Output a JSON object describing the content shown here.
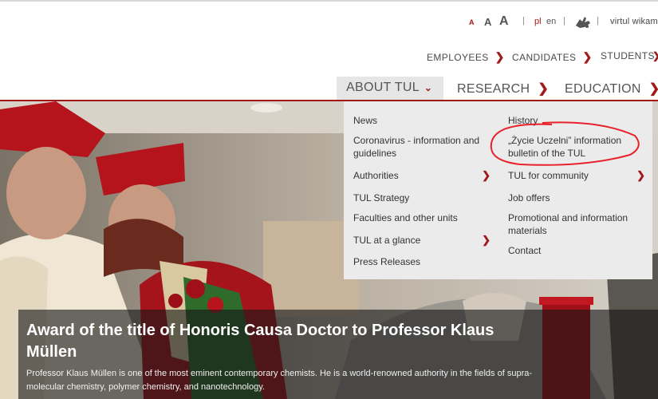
{
  "utility": {
    "font_small": "A",
    "font_medium": "A",
    "font_large": "A",
    "sep": "|",
    "lang_pl": "pl",
    "lang_en": "en",
    "virtual_label": "virtul wikam"
  },
  "sections": [
    {
      "label": "EMPLOYEES",
      "chev": "❯"
    },
    {
      "label": "CANDIDATES",
      "chev": "❯"
    },
    {
      "label": "STUDENTS"
    }
  ],
  "sections_more": "❯",
  "mainnav": {
    "about": "ABOUT TUL",
    "about_chev": "⌄",
    "research": "RESEARCH",
    "education": "EDUCATION",
    "arrow": "❯"
  },
  "dropdown": {
    "left": [
      {
        "label": "News"
      },
      {
        "label": "Coronavirus - information and guidelines"
      },
      {
        "label": "Authorities",
        "arrow": "❯"
      },
      {
        "label": "TUL Strategy"
      },
      {
        "label": "Faculties and other units"
      },
      {
        "label": "TUL at a glance",
        "arrow": "❯"
      },
      {
        "label": "Press Releases"
      }
    ],
    "right": [
      {
        "label": "History"
      },
      {
        "label": "„Życie Uczelni” information bulletin of the TUL"
      },
      {
        "label": "TUL for community",
        "arrow": "❯"
      },
      {
        "label": "Job offers"
      },
      {
        "label": "Promotional and information materials"
      },
      {
        "label": "Contact"
      }
    ]
  },
  "hero": {
    "title": "Award of the title of Honoris Causa Doctor to Professor Klaus Müllen",
    "text": "Professor Klaus Müllen is one of the most eminent contemporary chemists. He is a world-renowned authority in the fields of supra-molecular chemistry, polymer chemistry, and nanotechnology."
  },
  "colors": {
    "accent": "#a01a1a",
    "annotation": "#e8202a",
    "dropdown_bg": "#ebebeb"
  }
}
